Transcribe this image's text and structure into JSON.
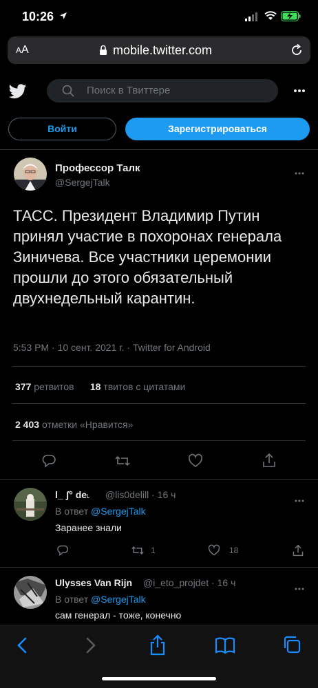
{
  "status_bar": {
    "time": "10:26"
  },
  "browser": {
    "aa_label_small": "A",
    "aa_label_big": "A",
    "url": "mobile.twitter.com"
  },
  "header": {
    "search_placeholder": "Поиск в Твиттере",
    "login_label": "Войти",
    "signup_label": "Зарегистрироваться"
  },
  "tweet": {
    "author_name": "Профессор Талк",
    "author_handle": "@SergejTalk",
    "text": "ТАСС. Президент Владимир Путин принял участие в похоронах генерала Зиничева. Все участники церемонии прошли до этого обязательный двухнедельный карантин.",
    "meta": "5:53 PM · 10 сент. 2021 г. · Twitter for Android",
    "retweets_count": "377",
    "retweets_label": "ретвитов",
    "quotes_count": "18",
    "quotes_label": "твитов с цитатами",
    "likes_count": "2 403",
    "likes_label": "отметки «Нравится»"
  },
  "replies": [
    {
      "name": "l_ ʃ° de˪",
      "handle": "@lis0delill · 16 ч",
      "reply_to_prefix": "В ответ",
      "reply_to_mention": "@SergejTalk",
      "text": "Заранее знали",
      "retweets": "1",
      "likes": "18"
    },
    {
      "name": "Ulysses Van Rijn",
      "handle": "@i_eto_projdet · 16 ч",
      "reply_to_prefix": "В ответ",
      "reply_to_mention": "@SergejTalk",
      "text": "сам генерал - тоже, конечно"
    }
  ],
  "colors": {
    "accent": "#1d9bf0",
    "background": "#000000",
    "muted": "#71767b",
    "text": "#e7e9ea"
  }
}
